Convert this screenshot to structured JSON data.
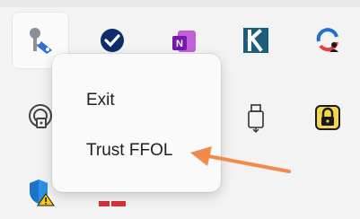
{
  "context_menu": {
    "items": [
      {
        "label": "Exit"
      },
      {
        "label": "Trust FFOL"
      }
    ]
  },
  "tray_icons": [
    {
      "name": "keys-icon"
    },
    {
      "name": "checkmark-circle-icon"
    },
    {
      "name": "onenote-icon"
    },
    {
      "name": "k-app-icon"
    },
    {
      "name": "edge-profile-icon"
    },
    {
      "name": "wifi-lock-icon"
    },
    {
      "name": "usb-drive-icon"
    },
    {
      "name": "lock-icon"
    },
    {
      "name": "shield-warning-icon"
    },
    {
      "name": "red-app-icon"
    }
  ],
  "colors": {
    "menu_bg": "#fafafa",
    "arrow": "#f28a4b",
    "background": "#f3f3f3"
  }
}
